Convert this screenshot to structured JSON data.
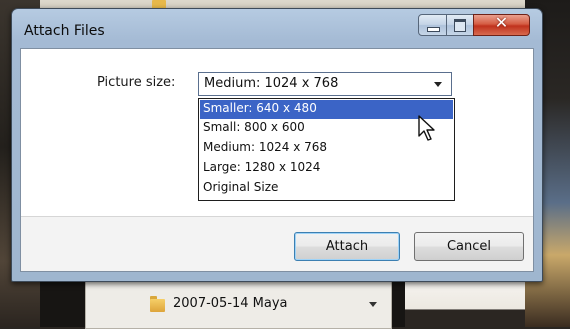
{
  "window": {
    "title": "Attach Files"
  },
  "picture_size": {
    "label": "Picture size:",
    "selected_value": "Medium: 1024 x 768",
    "options": [
      {
        "label": "Smaller: 640 x 480",
        "highlighted": true
      },
      {
        "label": "Small: 800 x 600",
        "highlighted": false
      },
      {
        "label": "Medium: 1024 x 768",
        "highlighted": false
      },
      {
        "label": "Large: 1280 x 1024",
        "highlighted": false
      },
      {
        "label": "Original Size",
        "highlighted": false
      }
    ]
  },
  "buttons": {
    "attach": "Attach",
    "cancel": "Cancel"
  },
  "background": {
    "folder_label": "2007-05-14 Maya"
  },
  "colors": {
    "selection": "#3b64c6",
    "close_button": "#c0321d",
    "title_bar": "#a4bad4"
  },
  "icons": [
    "folder-icon",
    "minimize-icon",
    "maximize-icon",
    "close-icon",
    "dropdown-arrow-icon",
    "mouse-pointer-icon"
  ]
}
